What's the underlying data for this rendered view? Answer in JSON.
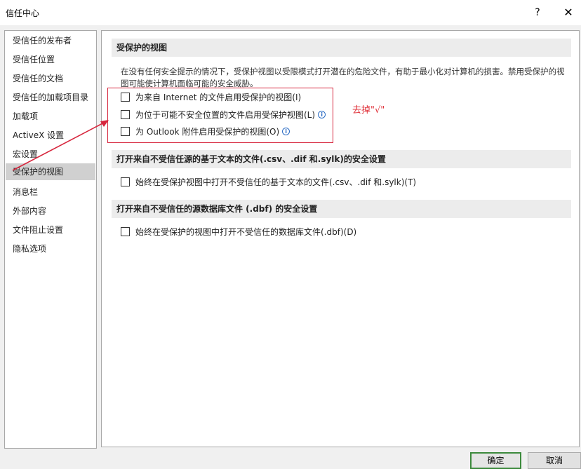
{
  "window": {
    "title": "信任中心",
    "help_label": "?",
    "close_label": "✕"
  },
  "sidebar": {
    "items": [
      {
        "label": "受信任的发布者"
      },
      {
        "label": "受信任位置"
      },
      {
        "label": "受信任的文档"
      },
      {
        "label": "受信任的加载项目录"
      },
      {
        "label": "加载项"
      },
      {
        "label": "ActiveX 设置"
      },
      {
        "label": "宏设置"
      },
      {
        "label": "受保护的视图",
        "selected": true
      },
      {
        "label": "消息栏"
      },
      {
        "label": "外部内容"
      },
      {
        "label": "文件阻止设置"
      },
      {
        "label": "隐私选项"
      }
    ]
  },
  "main": {
    "protected_view": {
      "header": "受保护的视图",
      "description": "在没有任何安全提示的情况下，受保护视图以受限模式打开潜在的危险文件，有助于最小化对计算机的损害。禁用受保护的视图可能使计算机面临可能的安全威胁。",
      "options": [
        {
          "label": "为来自 Internet 的文件启用受保护的视图(I)",
          "checked": false,
          "info": false
        },
        {
          "label": "为位于可能不安全位置的文件启用受保护视图(L)",
          "checked": false,
          "info": true
        },
        {
          "label": "为 Outlook 附件启用受保护的视图(O)",
          "checked": false,
          "info": true
        }
      ]
    },
    "text_files": {
      "header": "打开来自不受信任源的基于文本的文件(.csv、.dif 和.sylk)的安全设置",
      "option": "始终在受保护视图中打开不受信任的基于文本的文件(.csv、.dif 和.sylk)(T)",
      "checked": false
    },
    "dbf_files": {
      "header": "打开来自不受信任的源数据库文件 (.dbf) 的安全设置",
      "option": "始终在受保护的视图中打开不受信任的数据库文件(.dbf)(D)",
      "checked": false
    }
  },
  "annotation": {
    "text": "去掉\"√\"",
    "color": "#e0343c"
  },
  "footer": {
    "ok_label": "确定",
    "cancel_label": "取消"
  },
  "colors": {
    "accent_border": "#3c8a3c",
    "selection": "#d0d0d0",
    "annotation": "#d7263d"
  }
}
